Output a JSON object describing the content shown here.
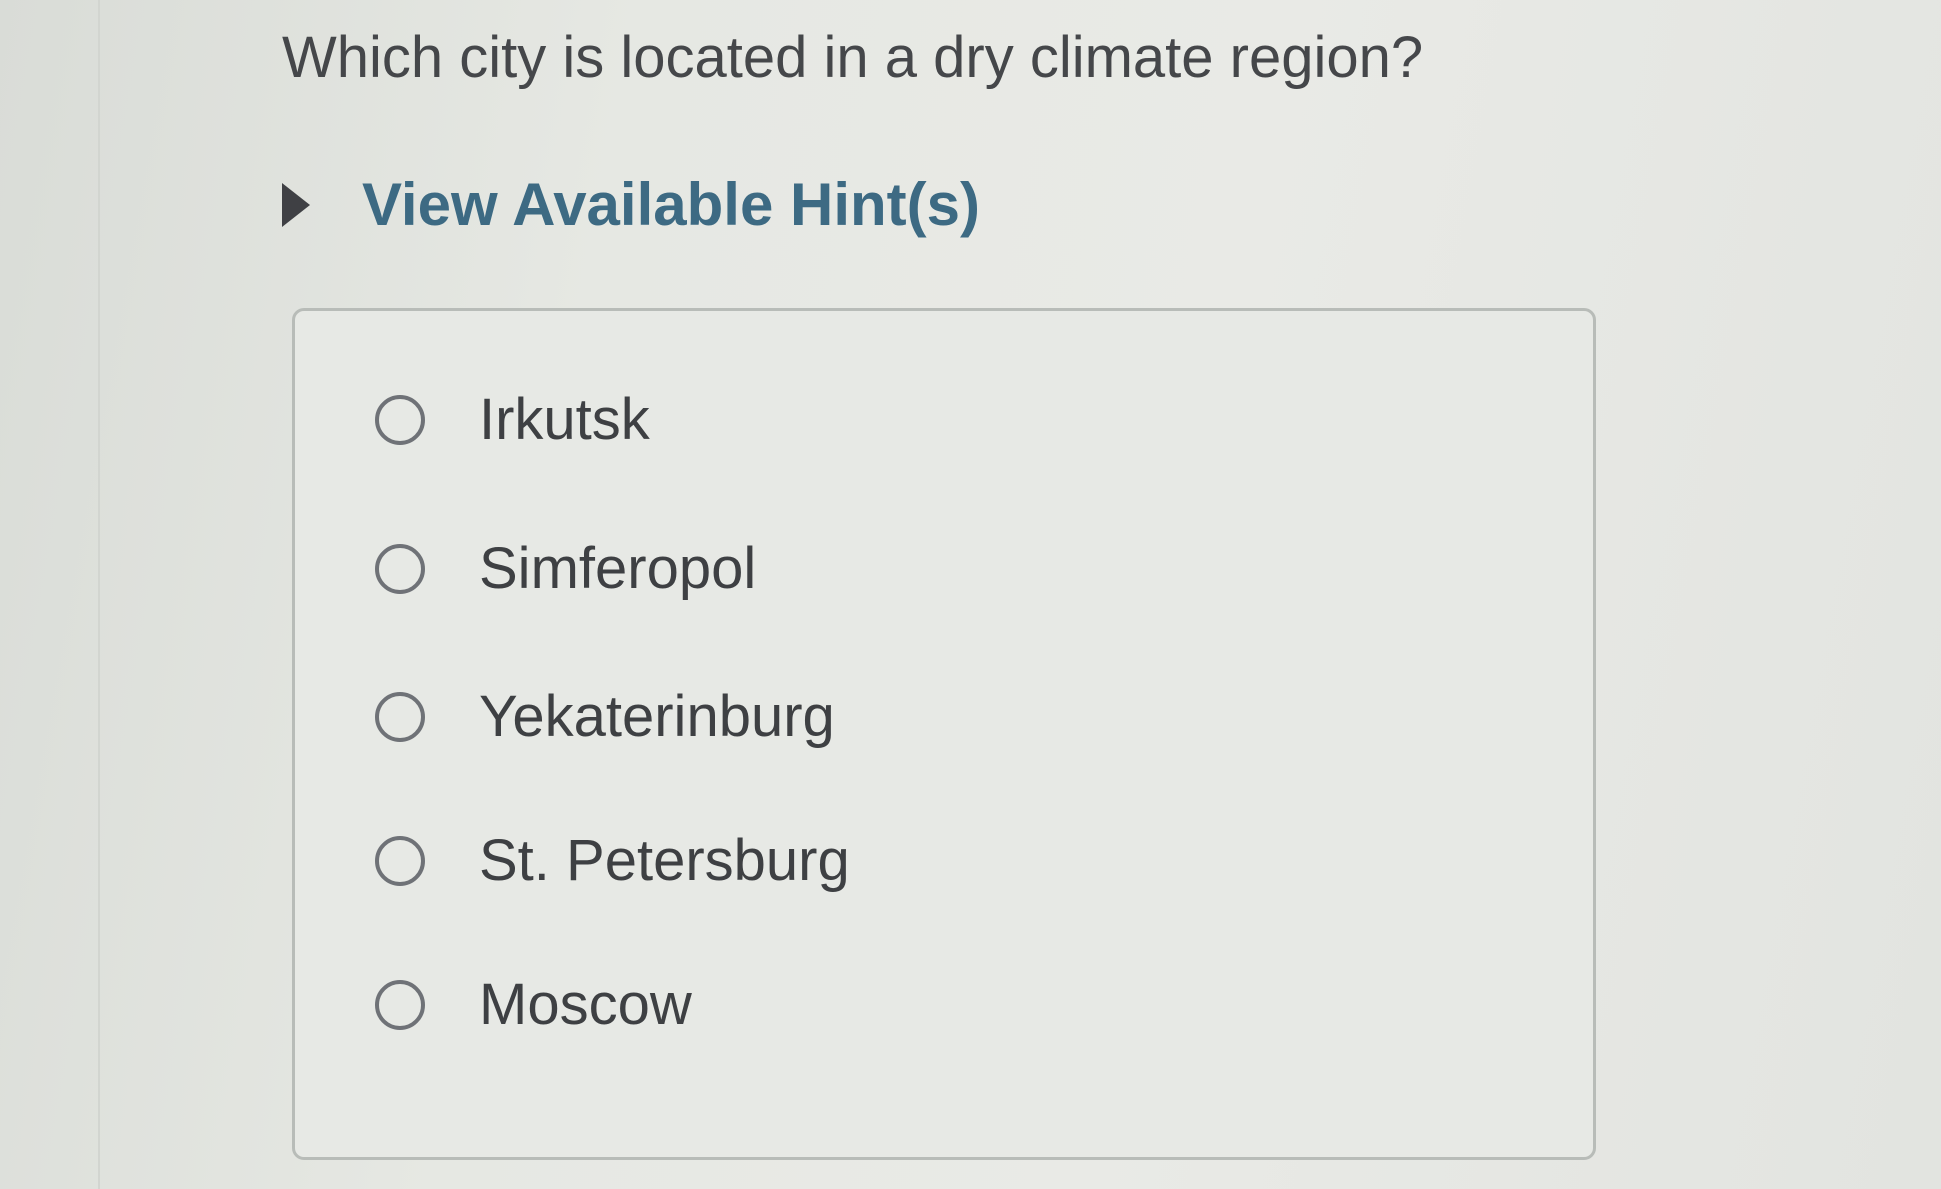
{
  "question": {
    "text": "Which city is located in a dry climate region?"
  },
  "hint": {
    "label": "View Available Hint(s)",
    "icon": "triangle-right-icon"
  },
  "options": [
    {
      "label": "Irkutsk",
      "selected": false
    },
    {
      "label": "Simferopol",
      "selected": false
    },
    {
      "label": "Yekaterinburg",
      "selected": false
    },
    {
      "label": "St. Petersburg",
      "selected": false
    },
    {
      "label": "Moscow",
      "selected": false
    }
  ],
  "colors": {
    "hint_link": "#3d6a83",
    "text": "#3e4043",
    "radio_border": "#6f7277",
    "box_border": "#b8bcb8"
  }
}
